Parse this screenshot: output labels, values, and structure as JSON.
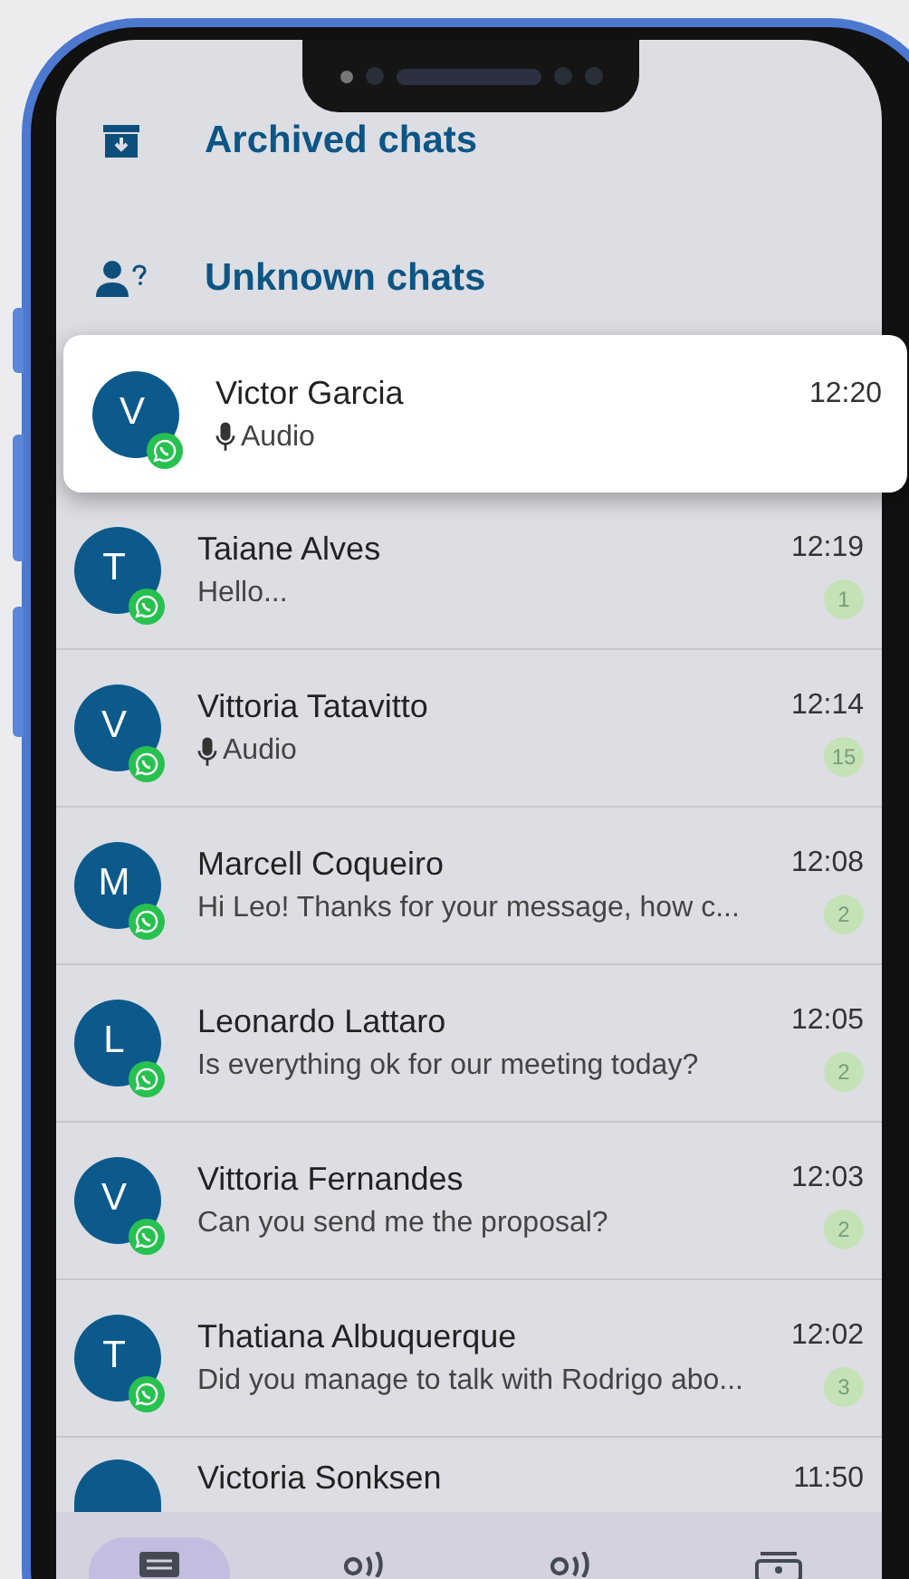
{
  "folders": [
    {
      "kind": "archived",
      "label": "Archived chats"
    },
    {
      "kind": "unknown",
      "label": "Unknown chats"
    }
  ],
  "chats": [
    {
      "initial": "V",
      "name": "Victor Garcia",
      "kind": "audio",
      "preview": "Audio",
      "time": "12:20",
      "highlighted": true
    },
    {
      "initial": "T",
      "name": "Taiane Alves",
      "kind": "text",
      "preview": "Hello...",
      "time": "12:19",
      "unread": "1",
      "highlighted": false
    },
    {
      "initial": "V",
      "name": "Vittoria Tatavitto",
      "kind": "audio",
      "preview": "Audio",
      "time": "12:14",
      "unread": "15",
      "highlighted": false
    },
    {
      "initial": "M",
      "name": "Marcell Coqueiro",
      "kind": "text",
      "preview": "Hi Leo! Thanks for your message, how c...",
      "time": "12:08",
      "unread": "2",
      "highlighted": false
    },
    {
      "initial": "L",
      "name": "Leonardo  Lattaro",
      "kind": "text",
      "preview": "Is everything ok for our meeting today?",
      "time": "12:05",
      "unread": "2",
      "highlighted": false
    },
    {
      "initial": "V",
      "name": "Vittoria Fernandes",
      "kind": "text",
      "preview": "Can you send me the proposal?",
      "time": "12:03",
      "unread": "2",
      "highlighted": false
    },
    {
      "initial": "T",
      "name": "Thatiana Albuquerque",
      "kind": "text",
      "preview": "Did you manage to talk with Rodrigo abo...",
      "time": "12:02",
      "unread": "3",
      "highlighted": false
    },
    {
      "name": "Victoria Sonksen",
      "time": "11:50",
      "highlighted": false
    }
  ],
  "nav": [
    {
      "kind": "chats",
      "selected": true
    },
    {
      "kind": "broadcast",
      "selected": false
    },
    {
      "kind": "broadcast",
      "selected": false
    },
    {
      "kind": "contacts",
      "selected": false
    }
  ]
}
